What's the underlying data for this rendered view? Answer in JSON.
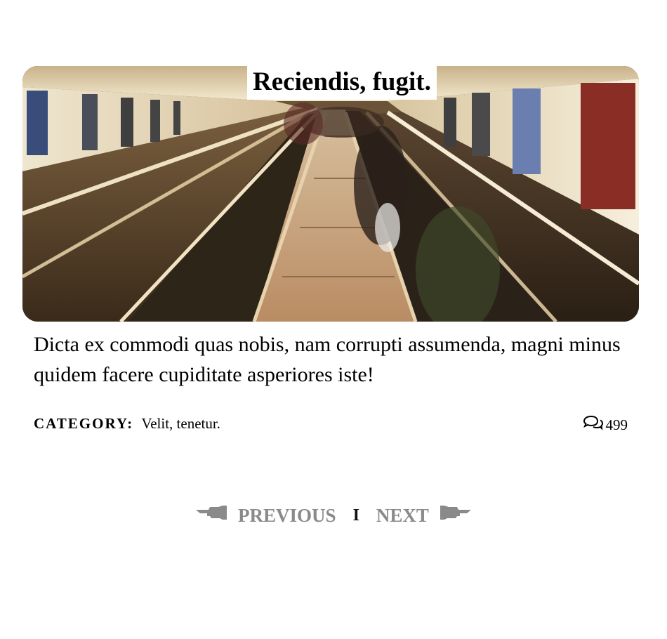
{
  "post": {
    "title": "Reciendis, fugit.",
    "excerpt": "Dicta ex commodi quas nobis, nam corrupti assumenda, magni minus quidem facere cupiditate asperiores iste!",
    "category_label": "CATEGORY:",
    "category_value": "Velit, tenetur.",
    "comment_count": "499",
    "image_subject": "escalators in a subway station"
  },
  "pagination": {
    "previous_label": "PREVIOUS",
    "separator": "I",
    "next_label": "NEXT"
  },
  "icons": {
    "comments": "comments-icon",
    "previous": "pointing-hand-left-icon",
    "next": "pointing-hand-right-icon"
  },
  "colors": {
    "text": "#000000",
    "pager_text": "#8a8a8a",
    "background": "#ffffff"
  }
}
